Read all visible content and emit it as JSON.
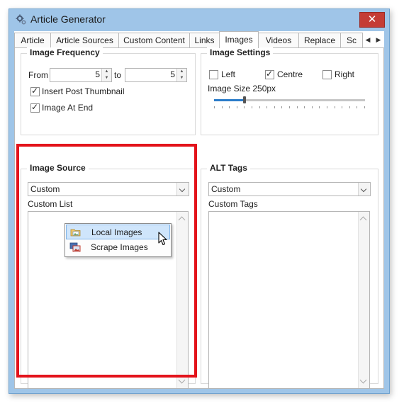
{
  "window": {
    "title": "Article Generator",
    "close_glyph": "✕",
    "icon": "gear-icon"
  },
  "tabs": [
    {
      "label": "Article"
    },
    {
      "label": "Article Sources"
    },
    {
      "label": "Custom Content"
    },
    {
      "label": "Links"
    },
    {
      "label": "Images",
      "active": true
    },
    {
      "label": "Videos"
    },
    {
      "label": "Replace"
    },
    {
      "label": "Sc"
    }
  ],
  "tab_scroll": {
    "left": "◀",
    "right": "▶"
  },
  "image_frequency": {
    "title": "Image Frequency",
    "from_label": "From",
    "from_value": "5",
    "to_label": "to",
    "to_value": "5",
    "insert_thumbnail_label": "Insert Post Thumbnail",
    "insert_thumbnail_checked": true,
    "image_at_end_label": "Image At End",
    "image_at_end_checked": true
  },
  "image_settings": {
    "title": "Image Settings",
    "left_label": "Left",
    "left_checked": false,
    "centre_label": "Centre",
    "centre_checked": true,
    "right_label": "Right",
    "right_checked": false,
    "size_label": "Image Size 250px",
    "size_slider_fraction": 0.2
  },
  "image_source": {
    "title": "Image Source",
    "selected": "Custom",
    "list_label": "Custom List"
  },
  "alt_tags": {
    "title": "ALT Tags",
    "selected": "Custom",
    "list_label": "Custom Tags"
  },
  "context_menu": {
    "items": [
      {
        "label": "Local Images",
        "icon": "folder-image-icon",
        "hovered": true
      },
      {
        "label": "Scrape Images",
        "icon": "scrape-images-icon",
        "hovered": false
      }
    ]
  },
  "colors": {
    "highlight": "#e3131b",
    "accent": "#2b7cc9",
    "close": "#c43c35",
    "frame": "#9fc5e8"
  },
  "check_glyph": "✓",
  "spin_up": "▲",
  "spin_down": "▼"
}
